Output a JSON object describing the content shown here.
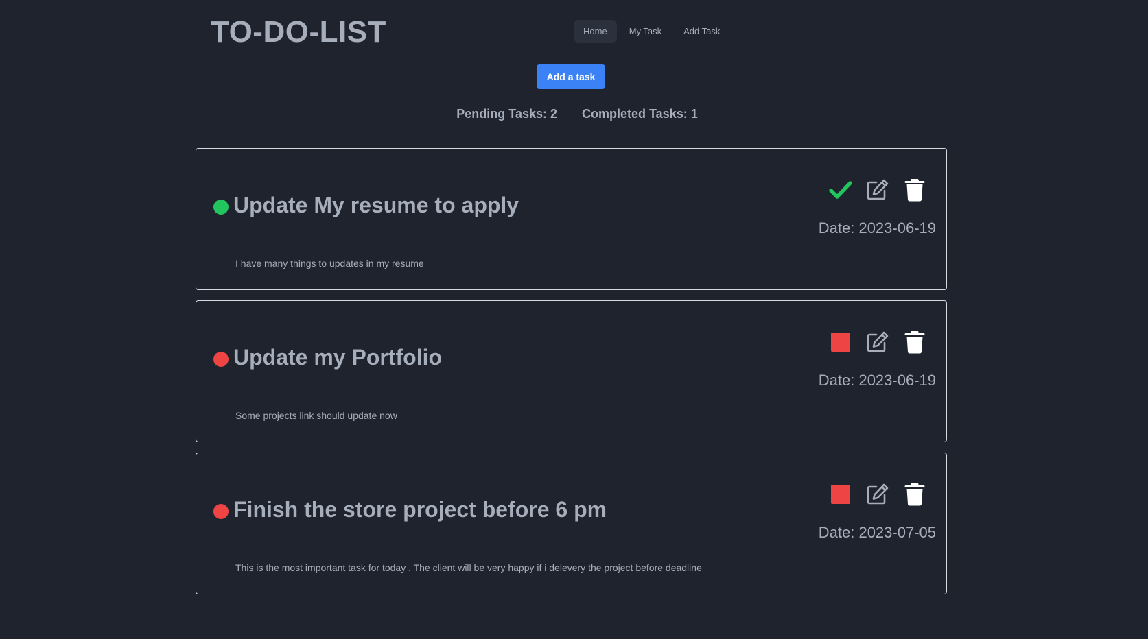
{
  "header": {
    "brand": "TO-DO-LIST",
    "nav": [
      {
        "label": "Home",
        "active": true
      },
      {
        "label": "My Task",
        "active": false
      },
      {
        "label": "Add Task",
        "active": false
      }
    ]
  },
  "add_button_label": "Add a task",
  "stats": {
    "pending": "Pending Tasks: 2",
    "completed": "Completed Tasks: 1"
  },
  "colors": {
    "background": "#1e232d",
    "text": "#a6adbb",
    "accent_blue": "#3b82f6",
    "done_green": "#22c55e",
    "pending_red": "#ef4444",
    "card_border": "#d6d9de"
  },
  "tasks": [
    {
      "title": "Update My resume to apply",
      "description": "I have many things to updates in my resume",
      "date": "Date: 2023-06-19",
      "status": "completed",
      "status_color": "#22c55e",
      "toggle_icon": "check-icon"
    },
    {
      "title": "Update my Portfolio",
      "description": "Some projects link should update now",
      "date": "Date: 2023-06-19",
      "status": "pending",
      "status_color": "#ef4444",
      "toggle_icon": "red-square-icon"
    },
    {
      "title": "Finish the store project before 6 pm",
      "description": "This is the most important task for today , The client will be very happy if i delevery the project before deadline",
      "date": "Date: 2023-07-05",
      "status": "pending",
      "status_color": "#ef4444",
      "toggle_icon": "red-square-icon"
    }
  ]
}
